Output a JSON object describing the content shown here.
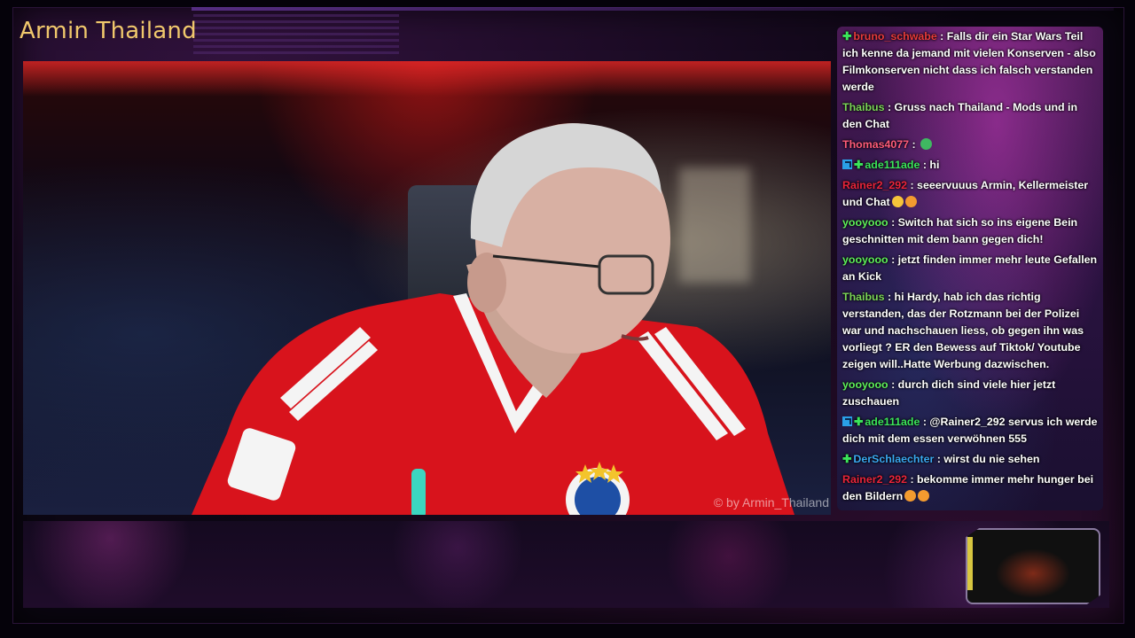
{
  "stream": {
    "channel_title": "Armin Thailand",
    "watermark": "© by Armin_Thailand"
  },
  "chat": {
    "messages": [
      {
        "user": "bruno_schwabe",
        "user_color": "#e83b3b",
        "badges": [
          "green"
        ],
        "text": "Falls dir ein Star Wars Teil ich kenne da jemand mit vielen Konserven - also Filmkonserven nicht dass ich falsch verstanden werde",
        "emotes": []
      },
      {
        "user": "Thaibus",
        "user_color": "#7bd657",
        "badges": [],
        "text": "Gruss nach Thailand - Mods und in den Chat",
        "emotes": []
      },
      {
        "user": "Thomas4077",
        "user_color": "#ff5c7a",
        "badges": [],
        "text": "",
        "emotes": [
          "green"
        ]
      },
      {
        "user": "ade111ade",
        "user_color": "#3be55a",
        "badges": [
          "blue",
          "green"
        ],
        "text": "hi",
        "emotes": []
      },
      {
        "user": "Rainer2_292",
        "user_color": "#e8243a",
        "badges": [],
        "text": "seeervuuus Armin, Kellermeister und Chat",
        "emotes": [
          "yellow",
          "orange"
        ]
      },
      {
        "user": "yooyooo",
        "user_color": "#5ef05a",
        "badges": [],
        "text": "Switch hat sich so ins eigene Bein geschnitten mit dem bann gegen dich!",
        "emotes": []
      },
      {
        "user": "yooyooo",
        "user_color": "#5ef05a",
        "badges": [],
        "text": "jetzt finden immer mehr leute Gefallen an Kick",
        "emotes": []
      },
      {
        "user": "Thaibus",
        "user_color": "#7bd657",
        "badges": [],
        "text": "hi Hardy, hab ich das richtig verstanden, das der Rotzmann bei der Polizei war und nachschauen liess, ob gegen ihn was vorliegt ? ER den Bewess auf Tiktok/ Youtube zeigen will..Hatte Werbung dazwischen.",
        "emotes": []
      },
      {
        "user": "yooyooo",
        "user_color": "#5ef05a",
        "badges": [],
        "text": "durch dich sind viele hier jetzt zuschauen",
        "emotes": []
      },
      {
        "user": "ade111ade",
        "user_color": "#3be55a",
        "badges": [
          "blue",
          "green"
        ],
        "text": "@Rainer2_292 servus ich werde dich mit dem essen verwöhnen 555",
        "emotes": []
      },
      {
        "user": "DerSchlaechter",
        "user_color": "#3aa8f0",
        "badges": [
          "green"
        ],
        "text": "wirst du nie sehen",
        "emotes": []
      },
      {
        "user": "Rainer2_292",
        "user_color": "#e8243a",
        "badges": [],
        "text": "bekomme immer mehr hunger bei den Bildern",
        "emotes": [
          "orange",
          "orange"
        ]
      }
    ]
  }
}
